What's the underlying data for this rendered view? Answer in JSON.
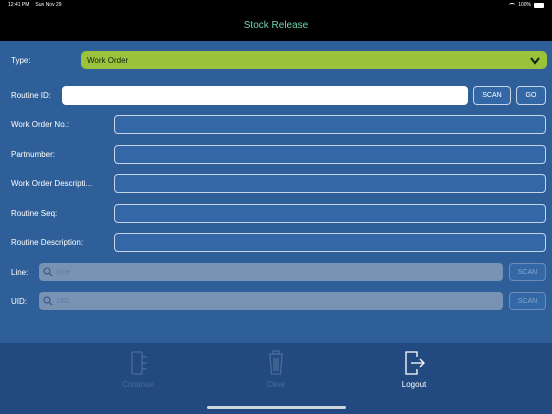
{
  "status_bar": {
    "time": "12:41 PM",
    "date": "Sun Nov 29",
    "battery": "100%"
  },
  "nav": {
    "title": "Stock Release"
  },
  "form": {
    "type_label": "Type:",
    "type_value": "Work Order",
    "routine_id_label": "Routine ID:",
    "routine_id_value": "",
    "scan_label": "SCAN",
    "go_label": "GO",
    "work_order_no_label": "Work Order No.:",
    "partnumber_label": "Partnumber:",
    "work_order_desc_label": "Work Order Descripti...",
    "routine_seq_label": "Routine Seq:",
    "routine_desc_label": "Routine Description:",
    "line_label": "Line:",
    "line_placeholder": "Line",
    "line_scan_label": "SCAN",
    "uid_label": "UID:",
    "uid_placeholder": "UID",
    "uid_scan_label": "SCAN"
  },
  "tab_bar": {
    "continue_label": "Continue",
    "clear_label": "Clear",
    "logout_label": "Logout"
  },
  "colors": {
    "background": "#2f5f98",
    "type_select": "#9ac23a",
    "nav_title": "#6fd3a8"
  }
}
